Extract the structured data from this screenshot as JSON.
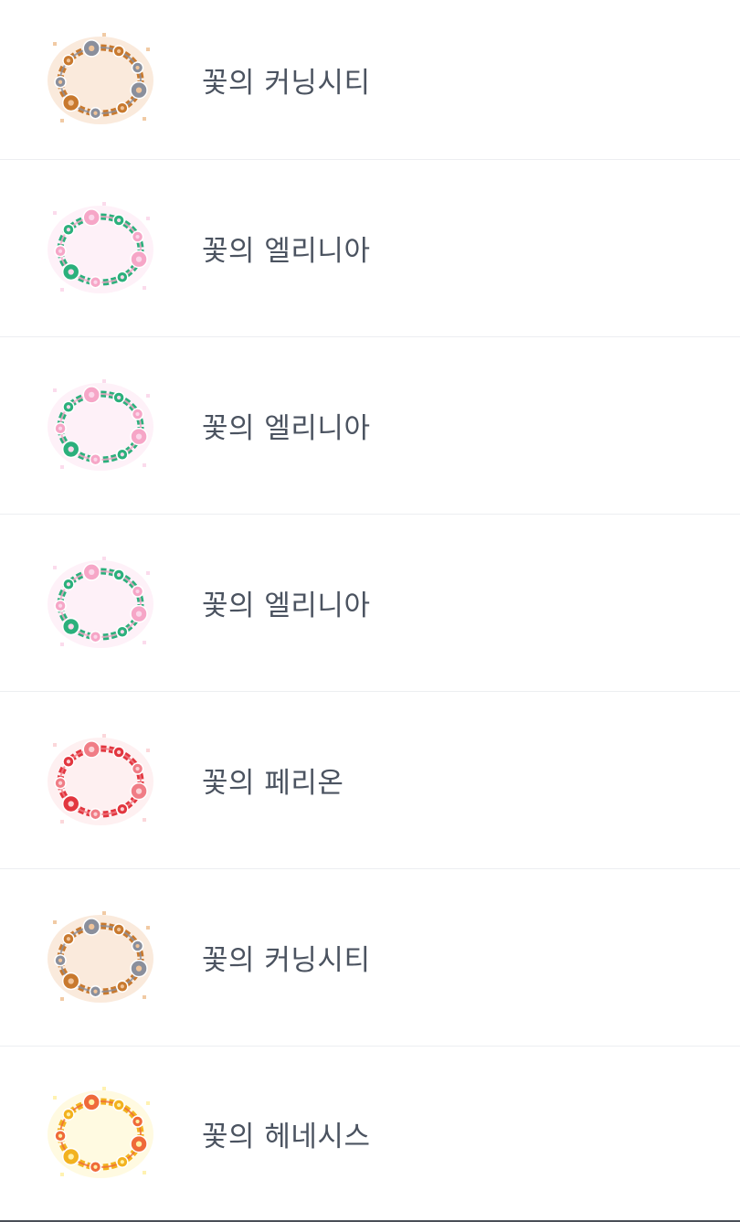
{
  "items": [
    {
      "label": "꽃의 커닝시티",
      "icon": "flower-wreath-kerning-icon",
      "colors": {
        "a": "#c8792e",
        "b": "#8a8f9c",
        "c": "#f0c49a"
      }
    },
    {
      "label": "꽃의 엘리니아",
      "icon": "flower-wreath-ellinia-icon",
      "colors": {
        "a": "#2bb07c",
        "b": "#f6a6c7",
        "c": "#fbd7ea"
      }
    },
    {
      "label": "꽃의 엘리니아",
      "icon": "flower-wreath-ellinia-icon",
      "colors": {
        "a": "#2bb07c",
        "b": "#f6a6c7",
        "c": "#fbd7ea"
      }
    },
    {
      "label": "꽃의 엘리니아",
      "icon": "flower-wreath-ellinia-icon",
      "colors": {
        "a": "#2bb07c",
        "b": "#f6a6c7",
        "c": "#fbd7ea"
      }
    },
    {
      "label": "꽃의 페리온",
      "icon": "flower-wreath-perion-icon",
      "colors": {
        "a": "#e2363f",
        "b": "#f07d86",
        "c": "#fbd3d6"
      }
    },
    {
      "label": "꽃의 커닝시티",
      "icon": "flower-wreath-kerning-icon",
      "colors": {
        "a": "#c8792e",
        "b": "#8a8f9c",
        "c": "#f0c49a"
      }
    },
    {
      "label": "꽃의 헤네시스",
      "icon": "flower-wreath-henesys-icon",
      "colors": {
        "a": "#f2b21f",
        "b": "#ef6a3a",
        "c": "#fff1a8"
      }
    }
  ]
}
